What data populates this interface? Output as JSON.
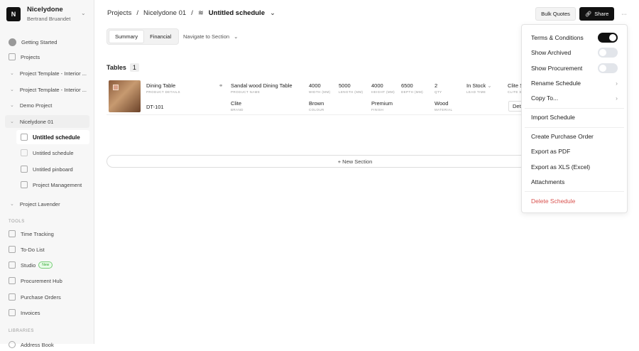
{
  "org": {
    "initial": "N",
    "name": "Nicelydone",
    "user": "Bertrand Bruandet"
  },
  "sidebar": {
    "getting_started": "Getting Started",
    "projects": "Projects",
    "project_items": [
      "Project Template - Interior ...",
      "Project Template - Interior ...",
      "Demo Project",
      "Nicelydone 01"
    ],
    "sub_items": [
      "Untitled schedule",
      "Untitled schedule",
      "Untitled pinboard",
      "Project Management"
    ],
    "project_lavender": "Project Lavender",
    "tools_label": "TOOLS",
    "tools": [
      "Time Tracking",
      "To-Do List",
      "Studio",
      "Procurement Hub",
      "Purchase Orders",
      "Invoices"
    ],
    "studio_badge": "New",
    "libraries_label": "LIBRARIES",
    "address_book": "Address Book"
  },
  "breadcrumb": {
    "projects": "Projects",
    "project": "Nicelydone 01",
    "current": "Untitled schedule"
  },
  "toolbar": {
    "bulk_quotes": "Bulk Quotes",
    "share": "Share",
    "more": "···"
  },
  "tabs": [
    "Summary",
    "Financial"
  ],
  "navigate": "Navigate to Section",
  "tables": {
    "label": "Tables",
    "count": "1"
  },
  "row": {
    "product": "Dining Table",
    "product_label": "PRODUCT DETAILS",
    "code": "DT-101",
    "name": "Sandal wood Dining Table",
    "name_label": "PRODUCT NAME",
    "brand": "Clite",
    "brand_label": "BRAND",
    "width": "4000",
    "width_label": "WIDTH (MM)",
    "length": "5000",
    "length_label": "LENGTH (MM)",
    "height": "4000",
    "height_label": "HEIGHT (MM)",
    "depth": "6500",
    "depth_label": "DEPTH (MM)",
    "qty": "2",
    "qty_label": "QTY",
    "lead": "In Stock",
    "lead_label": "LEAD TIME",
    "colour": "Brown",
    "colour_label": "COLOUR",
    "finish": "Premium",
    "finish_label": "FINISH",
    "material": "Wood",
    "material_label": "MATERIAL",
    "supplier": "Clite S",
    "supplier_label": "CLITE S",
    "details": "Deta"
  },
  "new_section": "+ New Section",
  "menu": {
    "terms": "Terms & Conditions",
    "archived": "Show Archived",
    "procurement": "Show Procurement",
    "rename": "Rename Schedule",
    "copy": "Copy To...",
    "import": "Import Schedule",
    "po": "Create Purchase Order",
    "pdf": "Export as PDF",
    "xls": "Export as XLS (Excel)",
    "attachments": "Attachments",
    "delete": "Delete Schedule"
  },
  "toggles": {
    "terms": true,
    "archived": false,
    "procurement": false
  },
  "colors": {
    "accent": "#111111",
    "danger": "#d9534f"
  }
}
